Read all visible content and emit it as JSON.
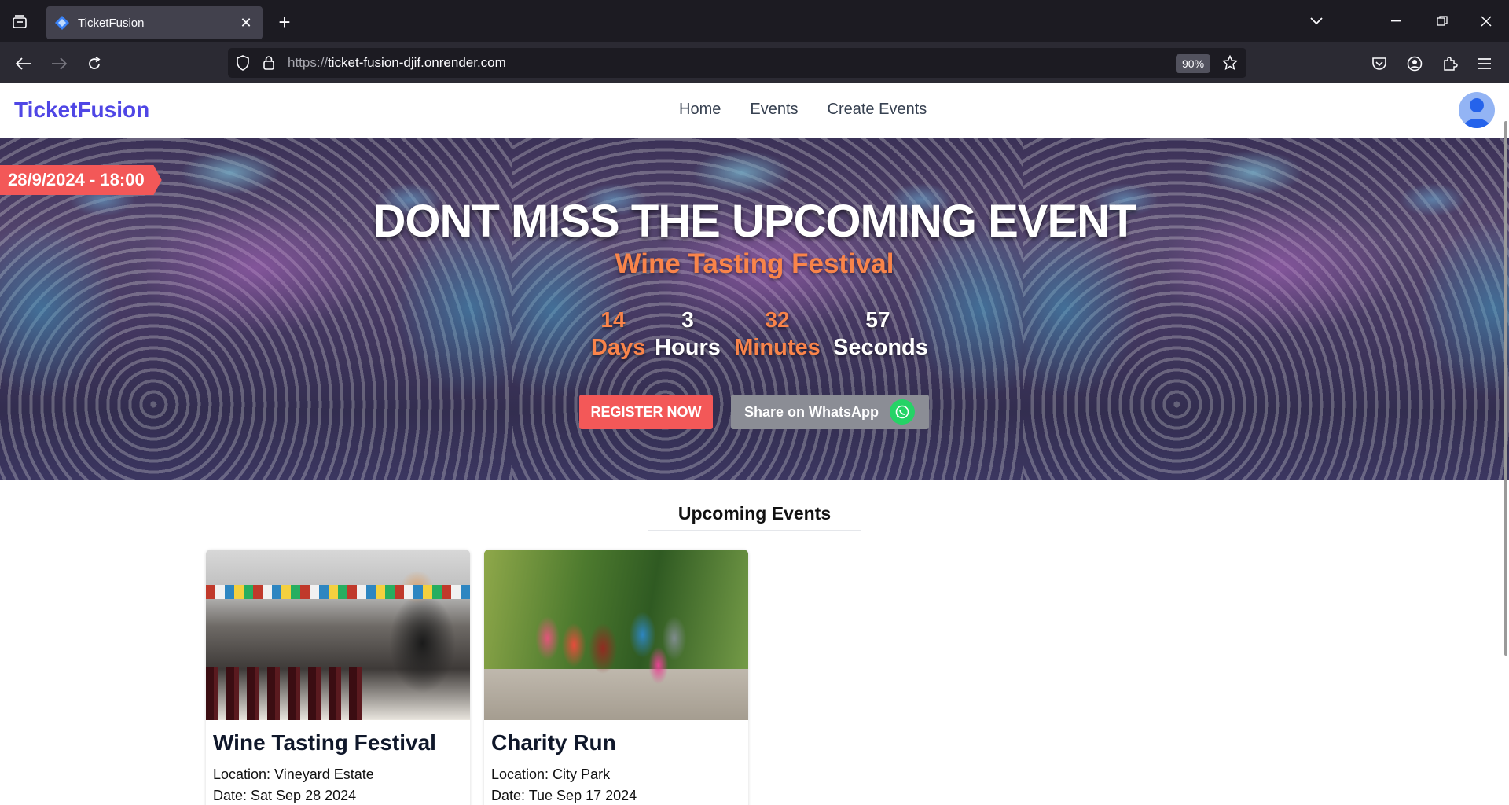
{
  "browser": {
    "tab_title": "TicketFusion",
    "url_protocol": "https://",
    "url_host": "ticket-fusion-djif.onrender.com",
    "zoom": "90%"
  },
  "site": {
    "brand": "TicketFusion",
    "nav": [
      "Home",
      "Events",
      "Create Events"
    ]
  },
  "hero": {
    "date_ribbon": "28/9/2024 - 18:00",
    "title": "DONT MISS THE UPCOMING EVENT",
    "subtitle": "Wine Tasting Festival",
    "countdown": [
      {
        "value": "14",
        "unit": "Days"
      },
      {
        "value": "3",
        "unit": "Hours"
      },
      {
        "value": "32",
        "unit": "Minutes"
      },
      {
        "value": "57",
        "unit": "Seconds"
      }
    ],
    "register_label": "REGISTER NOW",
    "whatsapp_label": "Share on WhatsApp"
  },
  "upcoming": {
    "heading": "Upcoming Events",
    "events": [
      {
        "title": "Wine Tasting Festival",
        "location": "Location: Vineyard Estate",
        "date": "Date: Sat Sep 28 2024"
      },
      {
        "title": "Charity Run",
        "location": "Location: City Park",
        "date": "Date: Tue Sep 17 2024"
      }
    ]
  },
  "colors": {
    "brand": "#4f46e5",
    "accent_red": "#f35858",
    "accent_orange": "#f9844a",
    "whatsapp_green": "#25d366"
  }
}
